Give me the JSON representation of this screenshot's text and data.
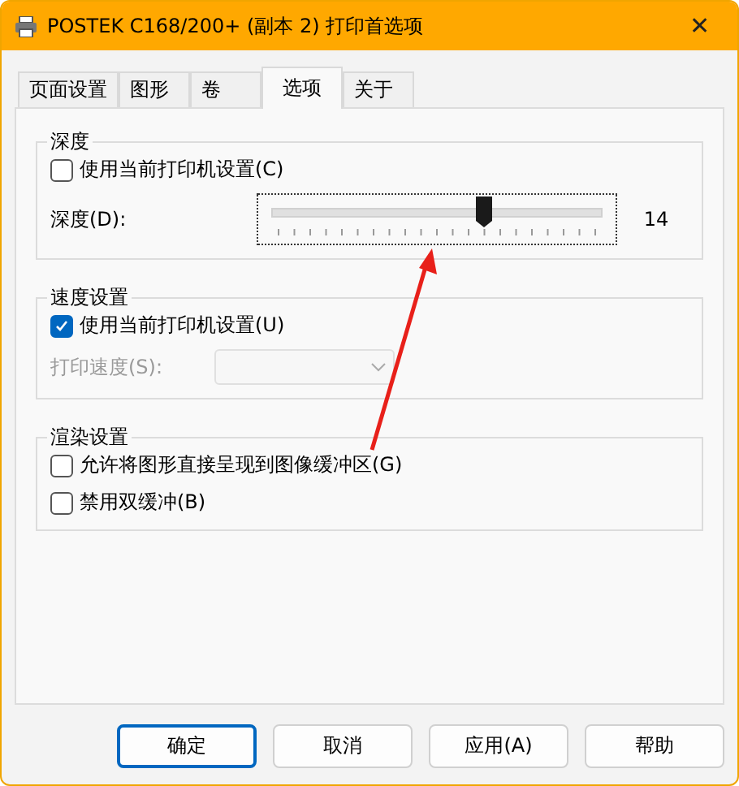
{
  "window": {
    "title": "POSTEK C168/200+ (副本 2) 打印首选项",
    "close": "✕"
  },
  "tabs": [
    {
      "label": "页面设置",
      "selected": false
    },
    {
      "label": "图形",
      "selected": false
    },
    {
      "label": "卷",
      "selected": false
    },
    {
      "label": "选项",
      "selected": true
    },
    {
      "label": "关于",
      "selected": false
    }
  ],
  "depth_group": {
    "title": "深度",
    "checkbox": {
      "label": "使用当前打印机设置(C)",
      "checked": false
    },
    "slider_label": "深度(D):",
    "slider": {
      "level": 0.67
    },
    "reading": "14"
  },
  "speed_group": {
    "title": "速度设置",
    "checkbox": {
      "label": "使用当前打印机设置(U)",
      "checked": true
    },
    "select_label": "打印速度(S):",
    "select_disabled": true
  },
  "render_group": {
    "title": "渲染设置",
    "checkboxes": [
      {
        "label": "允许将图形直接呈现到图像缓冲区(G)",
        "checked": false
      },
      {
        "label": "禁用双缓冲(B)",
        "checked": false
      }
    ]
  },
  "buttons": [
    {
      "label": "确定",
      "default": true
    },
    {
      "label": "取消",
      "default": false
    },
    {
      "label": "应用(A)",
      "default": false
    },
    {
      "label": "帮助",
      "default": false
    }
  ]
}
